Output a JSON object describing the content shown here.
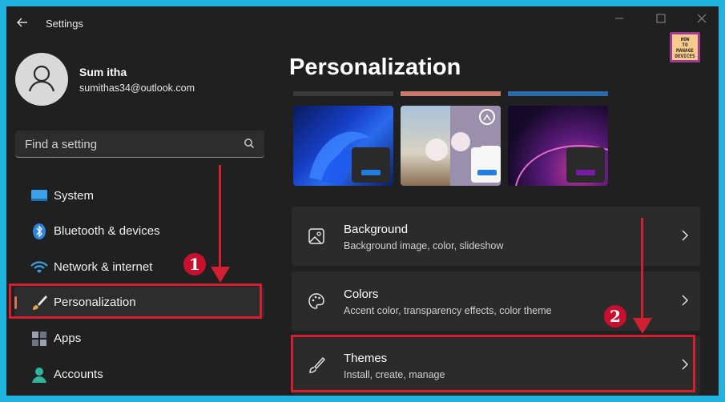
{
  "window": {
    "title": "Settings",
    "logo_text": [
      "HOW",
      "TO",
      "MANAGE",
      "DEVICES"
    ]
  },
  "user": {
    "name": "Sum itha",
    "email": "sumithas34@outlook.com"
  },
  "search": {
    "placeholder": "Find a setting"
  },
  "sidebar": {
    "items": [
      {
        "label": "System",
        "icon": "system-icon"
      },
      {
        "label": "Bluetooth & devices",
        "icon": "bluetooth-icon"
      },
      {
        "label": "Network & internet",
        "icon": "wifi-icon"
      },
      {
        "label": "Personalization",
        "icon": "brush-icon",
        "active": true
      },
      {
        "label": "Apps",
        "icon": "apps-icon"
      },
      {
        "label": "Accounts",
        "icon": "person-icon"
      }
    ]
  },
  "main": {
    "title": "Personalization",
    "cards": [
      {
        "title": "Background",
        "subtitle": "Background image, color, slideshow",
        "icon": "image-icon"
      },
      {
        "title": "Colors",
        "subtitle": "Accent color, transparency effects, color theme",
        "icon": "palette-icon"
      },
      {
        "title": "Themes",
        "subtitle": "Install, create, manage",
        "icon": "brush-icon"
      }
    ]
  },
  "annotations": {
    "step1": "1",
    "step2": "2"
  },
  "colors": {
    "accent": "#d97358",
    "highlight": "#d32030",
    "frame": "#21b4e0"
  }
}
